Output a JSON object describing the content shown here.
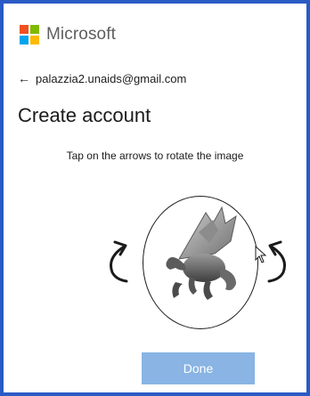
{
  "brand": {
    "name": "Microsoft",
    "logo_colors": [
      "#f25022",
      "#7fba00",
      "#00a4ef",
      "#ffb900"
    ]
  },
  "account": {
    "back_icon": "back-arrow-icon",
    "email": "palazzia2.unaids@gmail.com"
  },
  "page": {
    "title": "Create account",
    "instruction": "Tap on the arrows to rotate the image"
  },
  "puzzle": {
    "image": "dragon-figure",
    "rotate_left_icon": "rotate-left-icon",
    "rotate_right_icon": "rotate-right-icon"
  },
  "actions": {
    "done_label": "Done",
    "done_color": "#89b4e3"
  },
  "colors": {
    "frame_border": "#2a5bc4"
  }
}
